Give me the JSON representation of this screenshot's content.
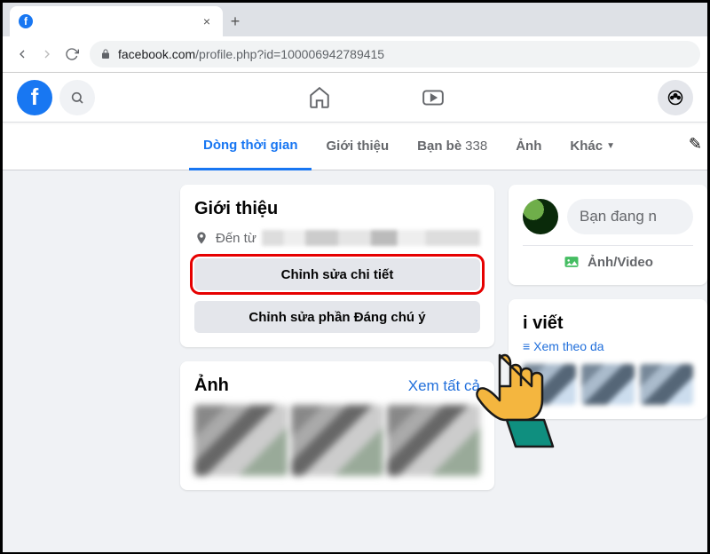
{
  "browser": {
    "tab_title": "",
    "url_host": "facebook.com",
    "url_path": "/profile.php?id=100006942789415"
  },
  "nav": {
    "tabs": [
      {
        "label": "Dòng thời gian"
      },
      {
        "label": "Giới thiệu"
      },
      {
        "label": "Bạn bè",
        "count": "338"
      },
      {
        "label": "Ảnh"
      },
      {
        "label": "Khác"
      }
    ]
  },
  "intro": {
    "title": "Giới thiệu",
    "from_label": "Đến từ",
    "edit_details": "Chỉnh sửa chi tiết",
    "edit_featured": "Chỉnh sửa phần Đáng chú ý"
  },
  "photos": {
    "title": "Ảnh",
    "see_all": "Xem tất cả"
  },
  "composer": {
    "placeholder": "Bạn đang n",
    "photo_video": "Ảnh/Video"
  },
  "posts": {
    "title_suffix": "i viết",
    "view_mode": "Xem theo da"
  }
}
